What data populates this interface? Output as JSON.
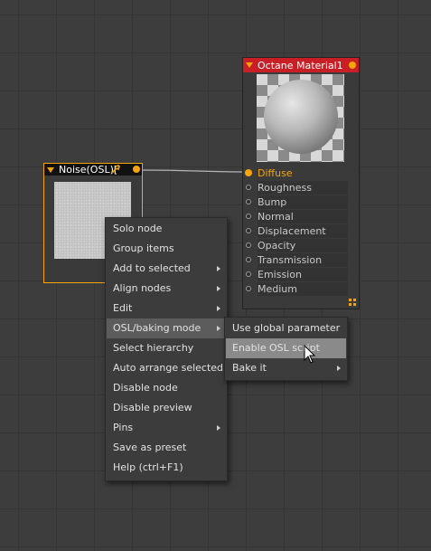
{
  "material_node": {
    "title": "Octane Material1",
    "pins": [
      {
        "label": "Diffuse",
        "active": true
      },
      {
        "label": "Roughness",
        "active": false
      },
      {
        "label": "Bump",
        "active": false
      },
      {
        "label": "Normal",
        "active": false
      },
      {
        "label": "Displacement",
        "active": false
      },
      {
        "label": "Opacity",
        "active": false
      },
      {
        "label": "Transmission",
        "active": false
      },
      {
        "label": "Emission",
        "active": false
      },
      {
        "label": "Medium",
        "active": false
      }
    ],
    "corner_icon": "resize-handle-icon"
  },
  "noise_node": {
    "title": "Noise(OSL)[",
    "settings_icon": "wrench-icon"
  },
  "context_menu": {
    "items": [
      {
        "label": "Solo node",
        "submenu": false
      },
      {
        "label": "Group items",
        "submenu": false
      },
      {
        "label": "Add to selected",
        "submenu": true
      },
      {
        "label": "Align nodes",
        "submenu": true
      },
      {
        "label": "Edit",
        "submenu": true
      },
      {
        "label": "OSL/baking mode",
        "submenu": true,
        "highlighted": true
      },
      {
        "label": "Select hierarchy",
        "submenu": false
      },
      {
        "label": "Auto arrange selected",
        "submenu": false
      },
      {
        "label": "Disable node",
        "submenu": false
      },
      {
        "label": "Disable preview",
        "submenu": false
      },
      {
        "label": "Pins",
        "submenu": true
      },
      {
        "label": "Save as preset",
        "submenu": false
      },
      {
        "label": "Help (ctrl+F1)",
        "submenu": false
      }
    ]
  },
  "submenu": {
    "items": [
      {
        "label": "Use global parameter",
        "submenu": false
      },
      {
        "label": "Enable OSL script",
        "submenu": false,
        "highlighted": true
      },
      {
        "label": "Bake it",
        "submenu": true
      }
    ]
  },
  "colors": {
    "canvas": "#3d3d3d",
    "material_header": "#c81f26",
    "accent_orange": "#f5a50a",
    "menu_bg": "#3c3c3c",
    "menu_highlight": "#5c5c5c",
    "submenu_highlight": "#8a8a8a"
  }
}
